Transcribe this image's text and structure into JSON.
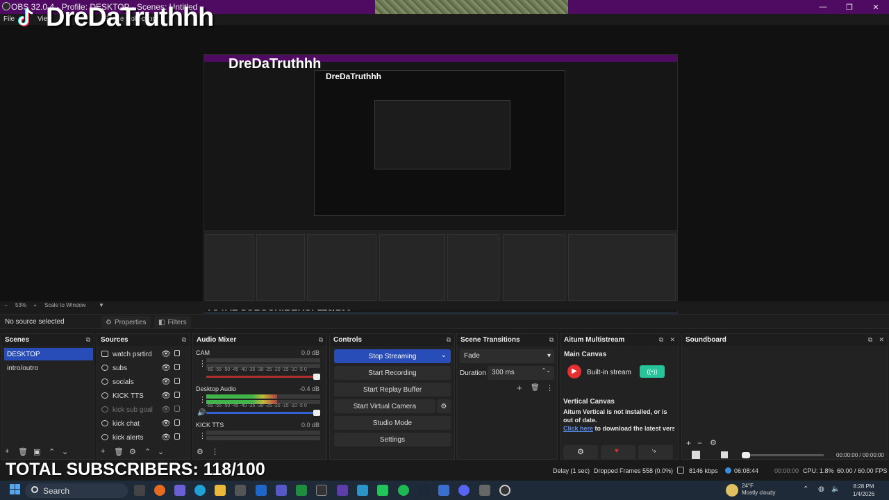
{
  "window": {
    "title": "OBS 32.0.4 - Profile: DESKTOP - Scenes: Untitled",
    "controls": [
      "—",
      "❐",
      "✕"
    ]
  },
  "menubar": {
    "items": [
      "File",
      "View",
      "Scene Collection"
    ]
  },
  "overlay": {
    "channel_name": "DreDaTruthhh",
    "subscribers": "TOTAL SUBSCRIBERS: 118/100"
  },
  "preview": {
    "zoom": "53%",
    "scale_mode": "Scale to Window"
  },
  "source_toolbar": {
    "no_source": "No source selected",
    "properties": "Properties",
    "filters": "Filters"
  },
  "scenes": {
    "title": "Scenes",
    "items": [
      {
        "label": "DESKTOP",
        "active": true
      },
      {
        "label": "intro/outro",
        "active": false
      }
    ]
  },
  "sources": {
    "title": "Sources",
    "items": [
      {
        "label": "watch psrtird",
        "visible": true
      },
      {
        "label": "subs",
        "visible": true
      },
      {
        "label": "socials",
        "visible": true
      },
      {
        "label": "KICK TTS",
        "visible": true
      },
      {
        "label": "kick sub goal",
        "visible": false
      },
      {
        "label": "kick chat",
        "visible": true
      },
      {
        "label": "kick alerts",
        "visible": true
      }
    ]
  },
  "audio_mixer": {
    "title": "Audio Mixer",
    "scale": "-60 -55 -50 -45 -40 -35 -30 -25 -20 -15 -10 -5 0",
    "channels": [
      {
        "name": "CAM",
        "db": "0.0 dB",
        "level": 0.0
      },
      {
        "name": "Desktop Audio",
        "db": "-0.4 dB",
        "level": 0.62
      },
      {
        "name": "KICK TTS",
        "db": "0.0 dB",
        "level": 0.0
      }
    ]
  },
  "controls": {
    "title": "Controls",
    "buttons": [
      "Stop Streaming",
      "Start Recording",
      "Start Replay Buffer",
      "Start Virtual Camera",
      "Studio Mode",
      "Settings"
    ]
  },
  "scene_transitions": {
    "title": "Scene Transitions",
    "transition": "Fade",
    "duration_label": "Duration",
    "duration_value": "300 ms"
  },
  "multistream": {
    "title": "Aitum Multistream",
    "main_canvas": "Main Canvas",
    "builtin": "Built-in stream",
    "vertical_title": "Vertical Canvas",
    "vertical_msg": "Aitum Vertical is not installed, or is out of date.",
    "link": "Click here",
    "link_rest": " to download the latest version",
    "accent": "#27c39a"
  },
  "soundboard": {
    "title": "Soundboard",
    "time": "00:00:00  /  00:00:00"
  },
  "status": {
    "delay": "Delay (1 sec)",
    "dropped": "Dropped Frames 558 (0.0%)",
    "kbps": "8146 kbps",
    "live_time": "06:08:44",
    "rec_time": "00:00:00",
    "cpu": "CPU: 1.8%",
    "fps": "60.00 / 60.00 FPS"
  },
  "taskbar": {
    "search": "Search",
    "weather_temp": "24°F",
    "weather_desc": "Mostly cloudy",
    "time": "8:28 PM",
    "date": "1/4/2026"
  }
}
